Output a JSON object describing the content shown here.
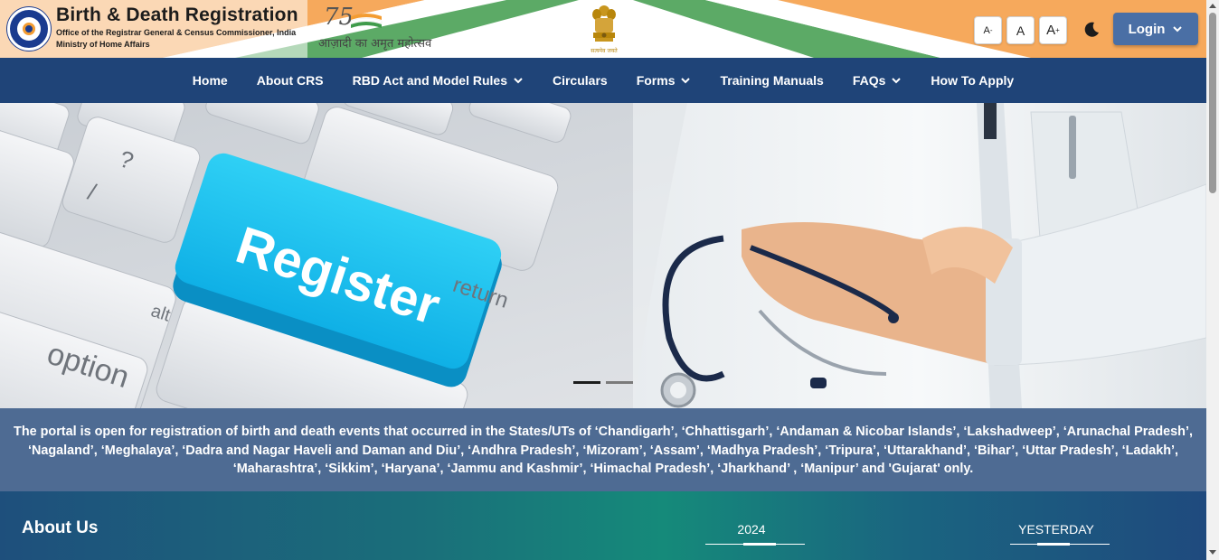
{
  "header": {
    "title": "Birth & Death Registration",
    "subtitle1": "Office of the Registrar General & Census Commissioner, India",
    "subtitle2": "Ministry of Home Affairs",
    "azadi_number": "75",
    "azadi_text": "आज़ादी का अमृत महोत्सव",
    "emblem_text": "सत्यमेव जयते",
    "font_decrease": "A",
    "font_normal": "A",
    "font_increase": "A",
    "font_decrease_sup": "-",
    "font_increase_sup": "+",
    "login_label": "Login"
  },
  "nav": {
    "items": [
      {
        "label": "Home",
        "dropdown": false
      },
      {
        "label": "About CRS",
        "dropdown": false
      },
      {
        "label": "RBD Act and Model Rules",
        "dropdown": true
      },
      {
        "label": "Circulars",
        "dropdown": false
      },
      {
        "label": "Forms",
        "dropdown": true
      },
      {
        "label": "Training Manuals",
        "dropdown": false
      },
      {
        "label": "FAQs",
        "dropdown": true
      },
      {
        "label": "How To Apply",
        "dropdown": false
      }
    ]
  },
  "hero": {
    "key_label": "Register",
    "key_return": "return",
    "key_alt": "alt",
    "key_option": "option",
    "key_question": "?",
    "key_slash": "/",
    "slide_count": 2,
    "active_slide": 1
  },
  "notice": {
    "text": "The portal is open for registration of birth and death events that occurred in the States/UTs of ‘Chandigarh’, ‘Chhattisgarh’, ‘Andaman & Nicobar Islands’, ‘Lakshadweep’, ‘Arunachal Pradesh’, ‘Nagaland’, ‘Meghalaya’, ‘Dadra and Nagar Haveli and Daman and Diu’, ‘Andhra Pradesh’, ‘Mizoram’, ‘Assam’, ‘Madhya Pradesh’, ‘Tripura’, ‘Uttarakhand’, ‘Bihar’, ‘Uttar Pradesh’, ‘Ladakh’, ‘Maharashtra’, ‘Sikkim’, ‘Haryana’, ‘Jammu and Kashmir’, ‘Himachal Pradesh’, ‘Jharkhand’ , ‘Manipur’ and 'Gujarat' only."
  },
  "about": {
    "title": "About Us"
  },
  "stats": {
    "year_label": "2024",
    "yesterday_label": "YESTERDAY"
  },
  "colors": {
    "nav_bg": "#1f4478",
    "notice_bg": "#4e6b93",
    "login_bg": "#4a6fa5",
    "saffron": "#f39c32",
    "green": "#3f9b4b"
  }
}
